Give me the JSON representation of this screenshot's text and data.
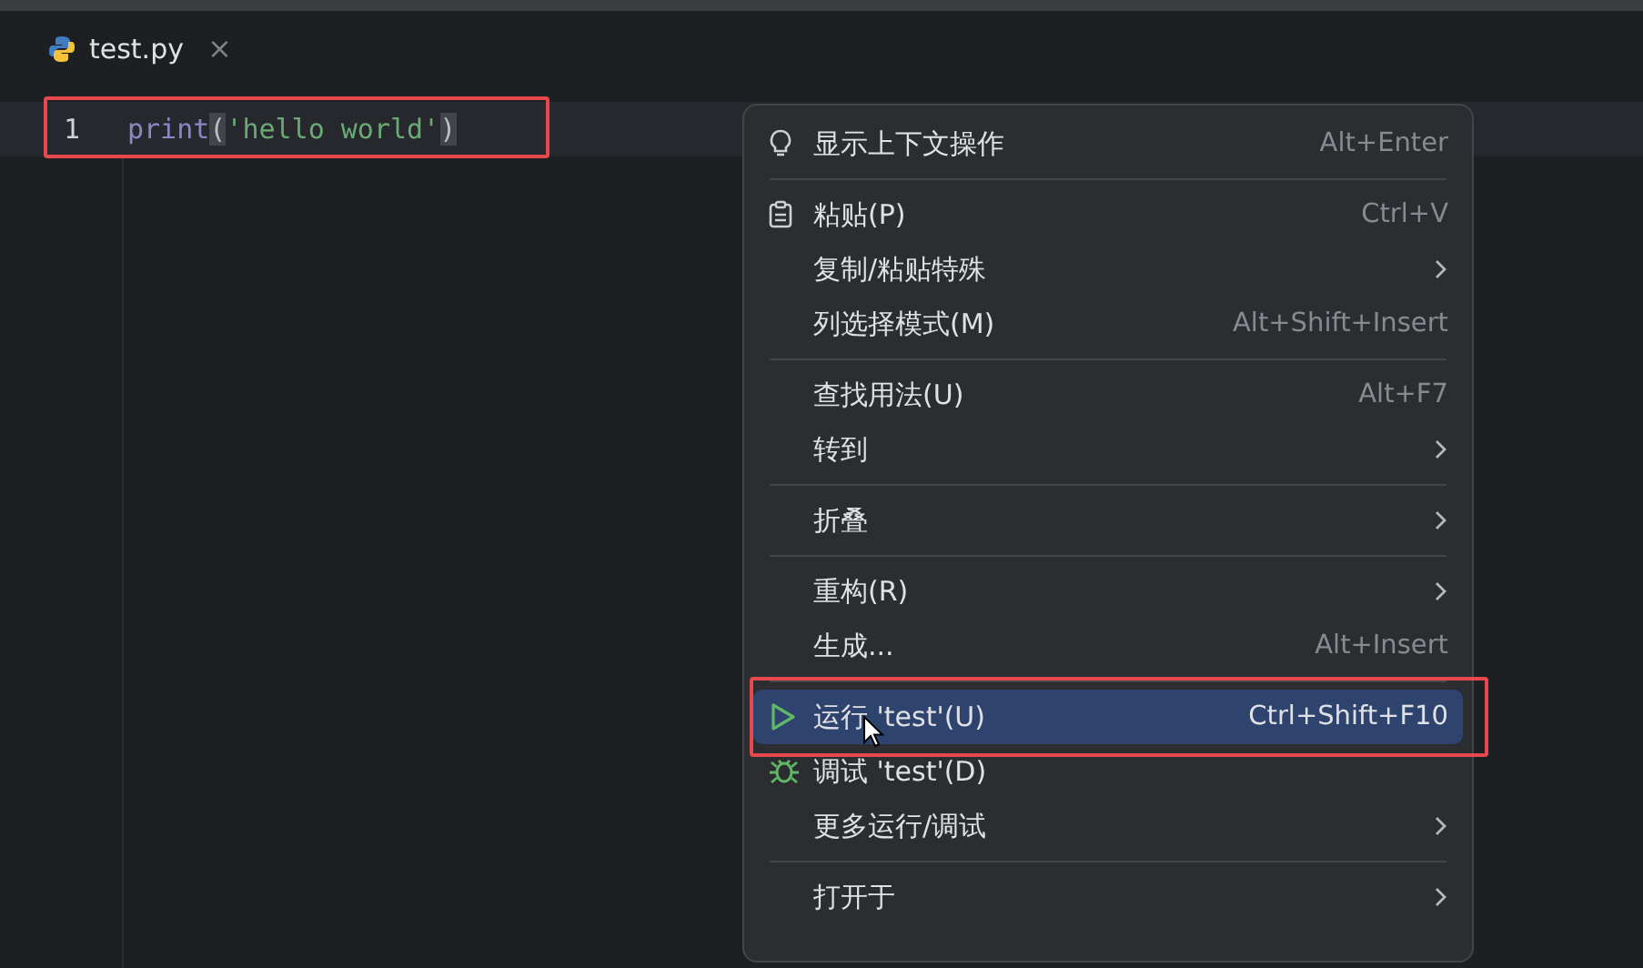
{
  "tabs": [
    {
      "label": "test.py",
      "selected": true,
      "closable": "×"
    }
  ],
  "editor": {
    "lines": [
      {
        "number": "1",
        "current": true,
        "annotated": true,
        "tokens": [
          {
            "text": "print",
            "kind": "builtin"
          },
          {
            "text": "(",
            "kind": "brace",
            "matched": true
          },
          {
            "text": "'hello world'",
            "kind": "string"
          },
          {
            "text": ")",
            "kind": "brace",
            "matched": true
          }
        ]
      }
    ]
  },
  "context_menu": {
    "groups": [
      [
        {
          "label": "显示上下文操作",
          "kind": "context",
          "shortcut": "Alt+Enter",
          "submenu": false,
          "selected": false
        }
      ],
      [
        {
          "label": "粘贴(P)",
          "kind": "paste",
          "shortcut": "Ctrl+V",
          "submenu": false,
          "selected": false
        },
        {
          "label": "复制/粘贴特殊",
          "submenu": true,
          "selected": false
        },
        {
          "label": "列选择模式(M)",
          "shortcut": "Alt+Shift+Insert",
          "submenu": false,
          "selected": false
        }
      ],
      [
        {
          "label": "查找用法(U)",
          "shortcut": "Alt+F7",
          "submenu": false,
          "selected": false
        },
        {
          "label": "转到",
          "submenu": true,
          "selected": false
        }
      ],
      [
        {
          "label": "折叠",
          "submenu": true,
          "selected": false
        }
      ],
      [
        {
          "label": "重构(R)",
          "submenu": true,
          "selected": false
        },
        {
          "label": "生成...",
          "shortcut": "Alt+Insert",
          "submenu": false,
          "selected": false
        }
      ],
      [
        {
          "label": "运行 'test'(U)",
          "kind": "run",
          "shortcut": "Ctrl+Shift+F10",
          "submenu": false,
          "selected": true,
          "annotated": true
        },
        {
          "label": "调试 'test'(D)",
          "kind": "debug",
          "submenu": false,
          "selected": false
        },
        {
          "label": "更多运行/调试",
          "submenu": true,
          "selected": false
        }
      ],
      [
        {
          "label": "打开于",
          "submenu": true,
          "selected": false
        }
      ]
    ]
  }
}
